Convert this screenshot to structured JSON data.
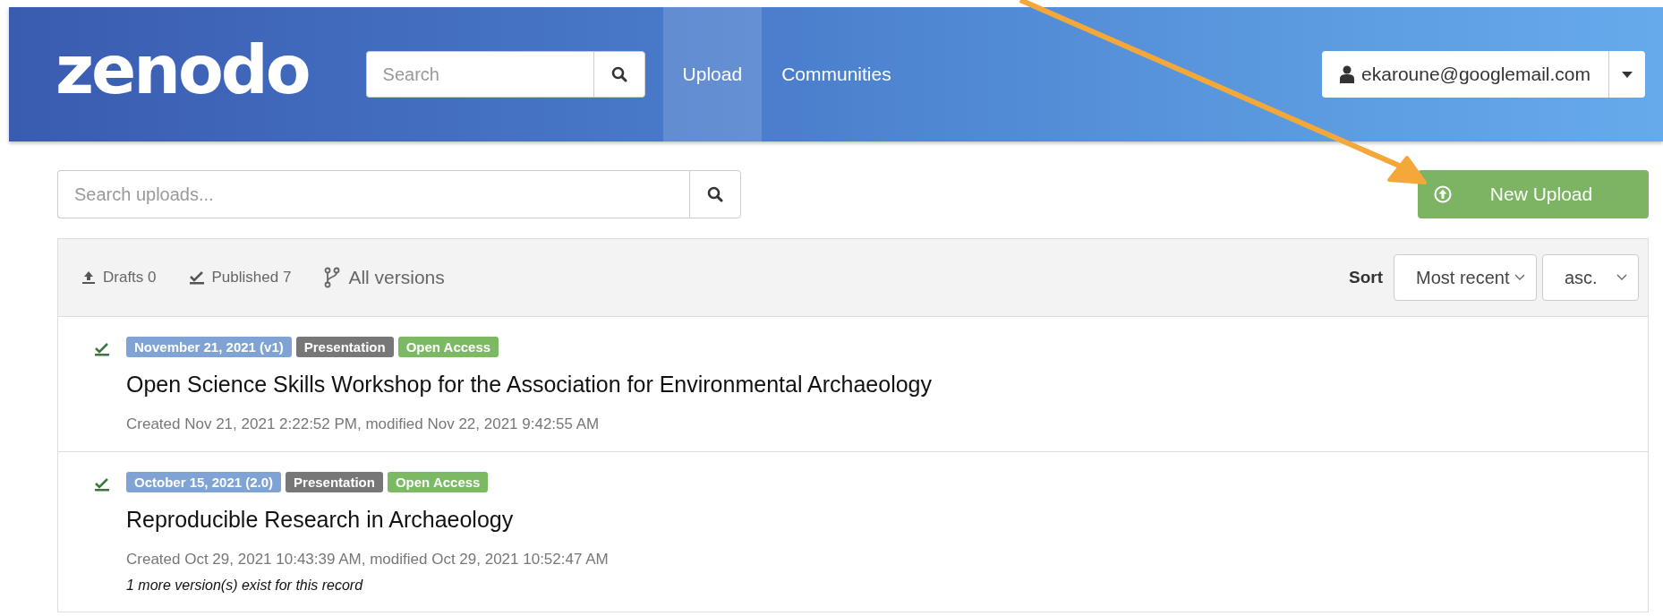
{
  "header": {
    "logo": "zenodo",
    "search": {
      "placeholder": "Search"
    },
    "nav": [
      {
        "label": "Upload",
        "selected": true
      },
      {
        "label": "Communities",
        "selected": false
      }
    ],
    "user": "ekaroune@googlemail.com"
  },
  "uploads_search": {
    "placeholder": "Search uploads..."
  },
  "new_upload_button": "New Upload",
  "filters": [
    {
      "label": "Drafts 0",
      "kind": "drafts"
    },
    {
      "label": "Published 7",
      "kind": "published"
    },
    {
      "label": "All versions",
      "kind": "versions"
    }
  ],
  "sort": {
    "label": "Sort",
    "field": "Most recent",
    "order": "asc."
  },
  "records": [
    {
      "badges": [
        {
          "text": "November 21, 2021 (v1)",
          "kind": "date"
        },
        {
          "text": "Presentation",
          "kind": "type"
        },
        {
          "text": "Open Access",
          "kind": "access"
        }
      ],
      "title": "Open Science Skills Workshop for the Association for Environmental Archaeology",
      "meta": "Created Nov 21, 2021 2:22:52 PM, modified Nov 22, 2021 9:42:55 AM"
    },
    {
      "badges": [
        {
          "text": "October 15, 2021 (2.0)",
          "kind": "date"
        },
        {
          "text": "Presentation",
          "kind": "type"
        },
        {
          "text": "Open Access",
          "kind": "access"
        }
      ],
      "title": "Reproducible Research in Archaeology",
      "meta": "Created Oct 29, 2021 10:43:39 AM, modified Oct 29, 2021 10:52:47 AM",
      "note": "1 more version(s) exist for this record"
    }
  ]
}
